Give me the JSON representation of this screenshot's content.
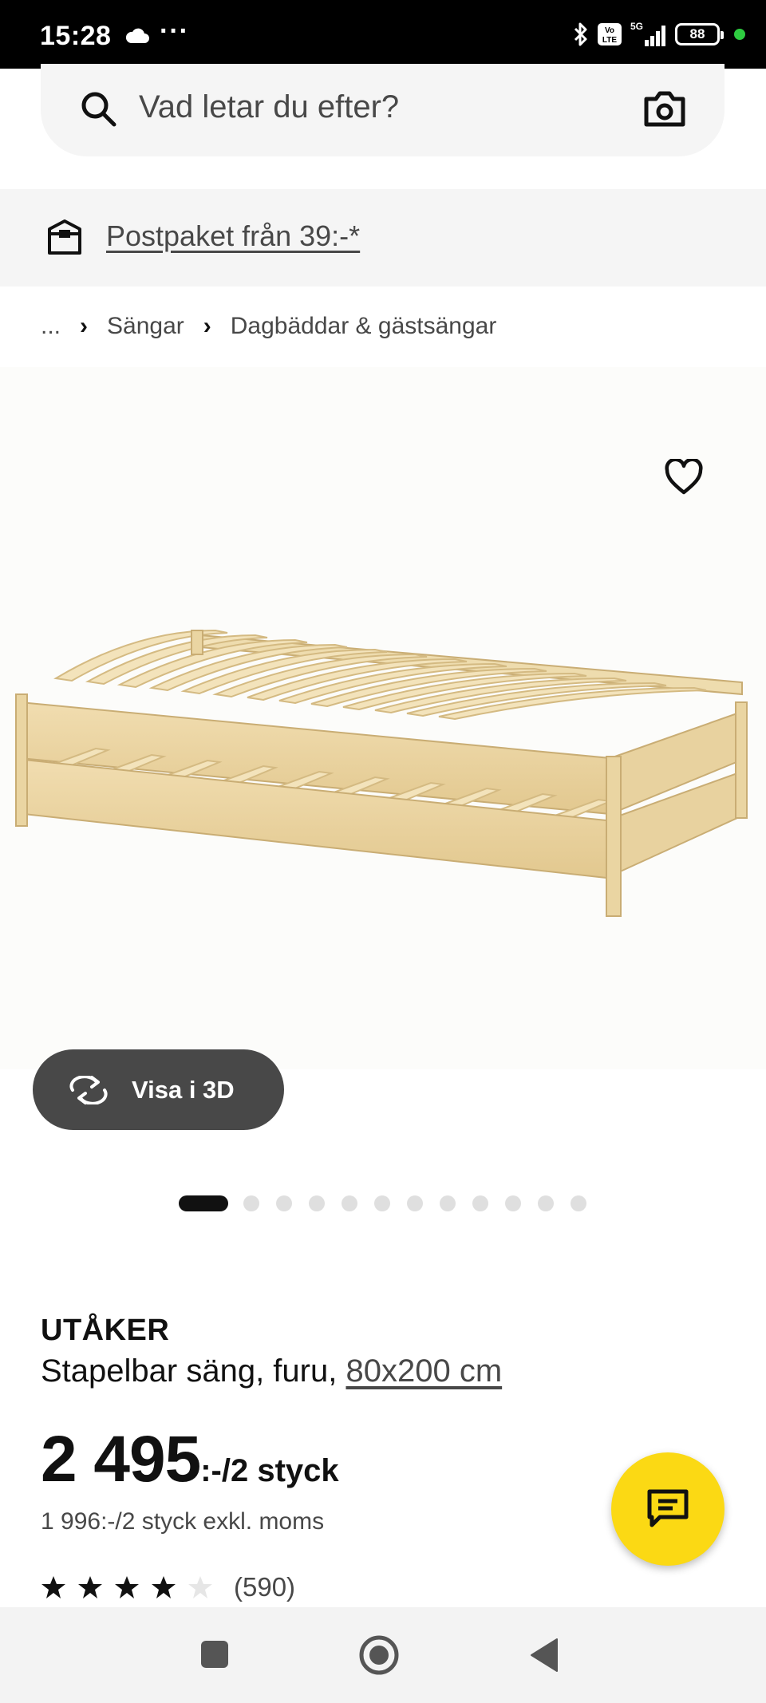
{
  "status_bar": {
    "time": "15:28",
    "more": "···",
    "network": "5G",
    "volte": "Vo LTE",
    "battery": "88"
  },
  "search": {
    "placeholder": "Vad letar du efter?",
    "icon": "search-icon",
    "camera_icon": "camera-icon"
  },
  "shipping_banner": {
    "text": "Postpaket från 39:-*",
    "icon": "parcel-icon"
  },
  "breadcrumb": {
    "ellipsis": "...",
    "items": [
      "Sängar",
      "Dagbäddar & gästsängar"
    ]
  },
  "gallery": {
    "view_3d_label": "Visa i 3D",
    "dot_count": 13,
    "active_index": 0
  },
  "product": {
    "name": "UTÅKER",
    "description": "Stapelbar säng, furu,",
    "size": "80x200 cm",
    "price_main": "2 495",
    "price_unit": ":-/2 styck",
    "price_ex_vat": "1 996:-/2 styck exkl. moms",
    "rating": 4,
    "rating_max": 5,
    "review_count": "(590)"
  },
  "colors": {
    "chat_yellow": "#fbd914",
    "pill_dark": "#484848",
    "banner_bg": "#f5f5f5"
  }
}
